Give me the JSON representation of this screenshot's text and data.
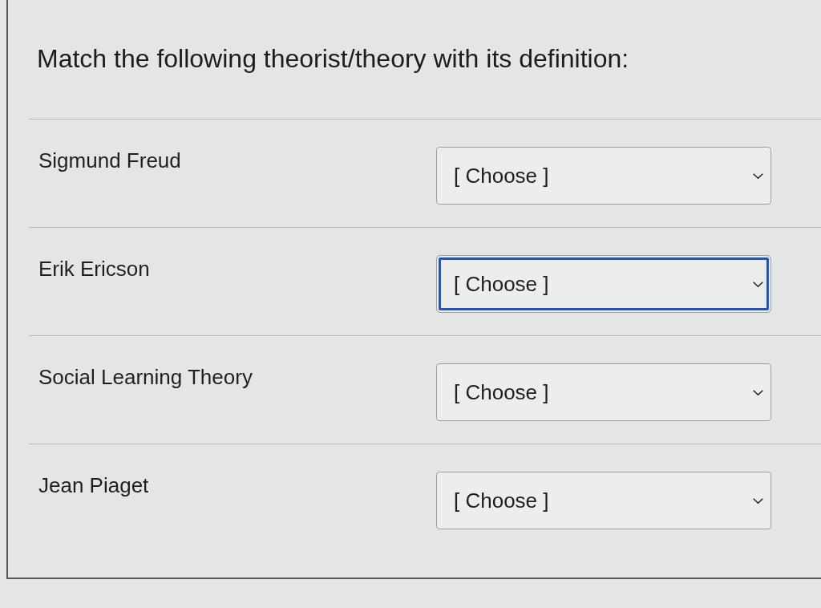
{
  "question": {
    "prompt": "Match the following theorist/theory with its definition:"
  },
  "pairs": [
    {
      "term": "Sigmund Freud",
      "answer": {
        "value": "[ Choose ]",
        "focused": false
      }
    },
    {
      "term": "Erik Ericson",
      "answer": {
        "value": "[ Choose ]",
        "focused": true
      }
    },
    {
      "term": "Social Learning Theory",
      "answer": {
        "value": "[ Choose ]",
        "focused": false
      }
    },
    {
      "term": "Jean Piaget",
      "answer": {
        "value": "[ Choose ]",
        "focused": false
      }
    }
  ]
}
